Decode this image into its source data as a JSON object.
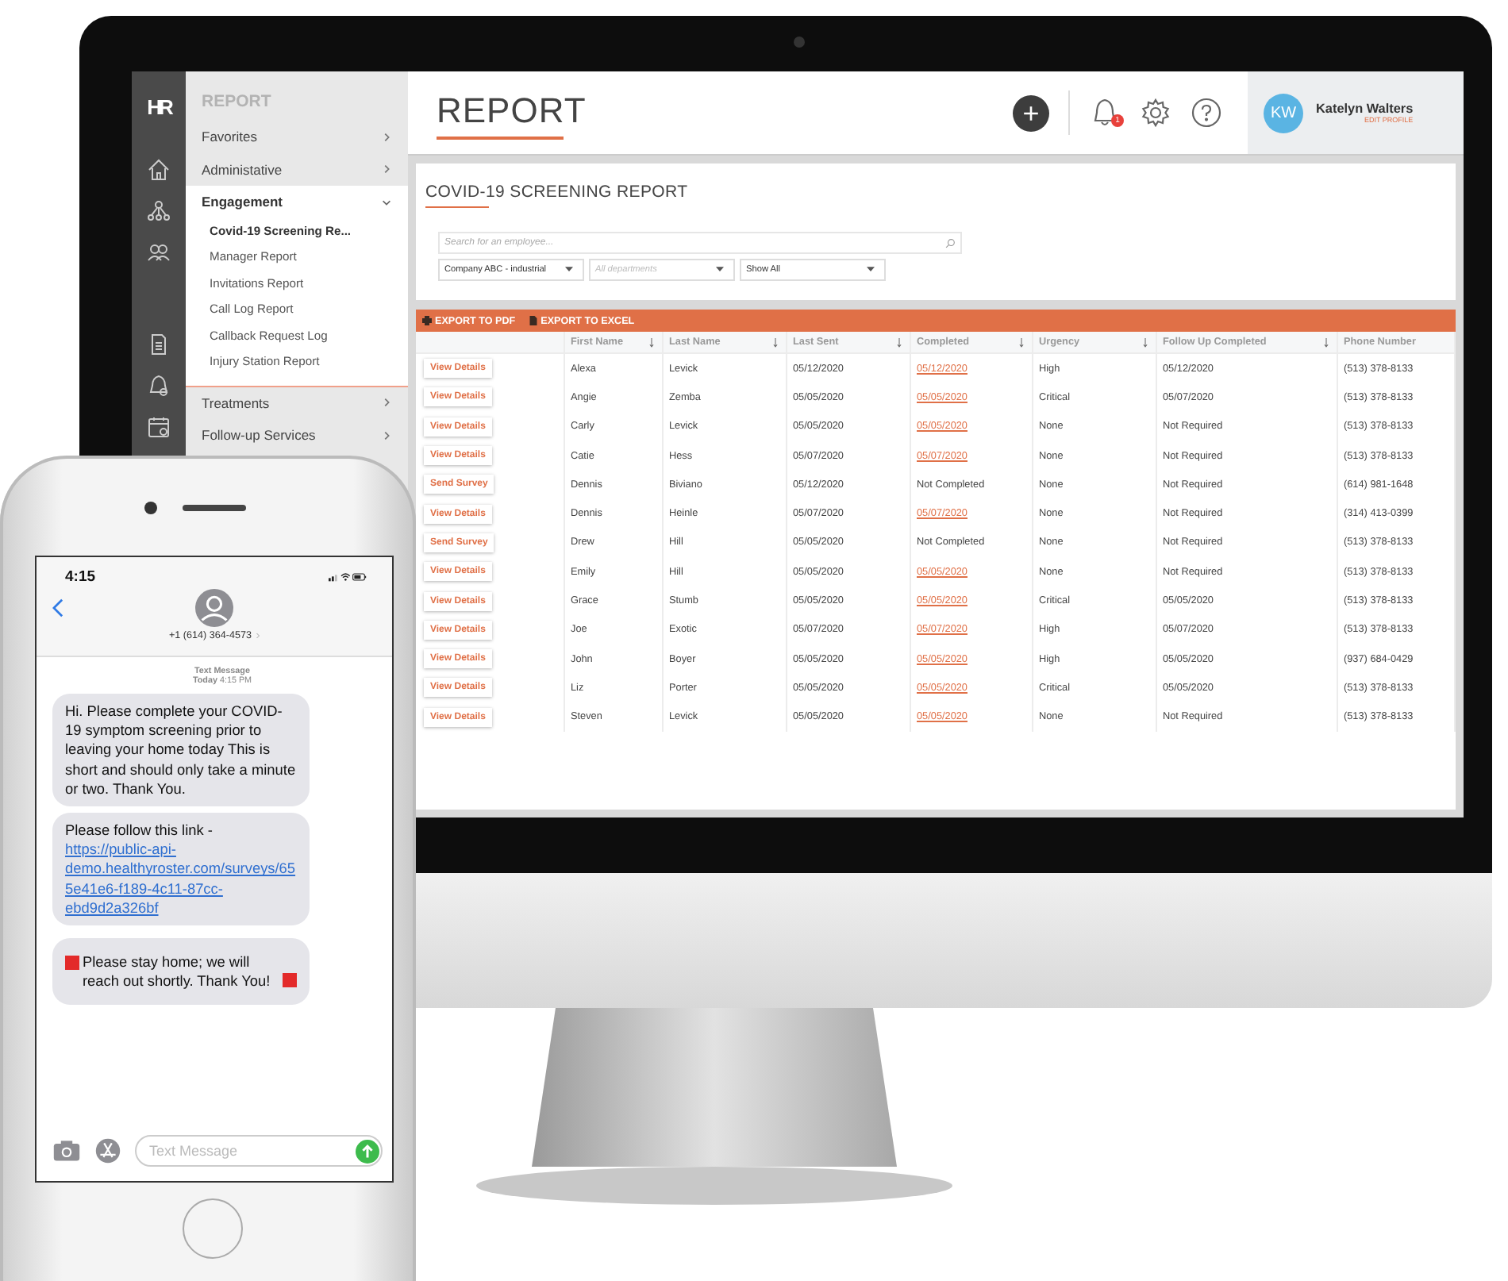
{
  "monitor": {
    "logo": "HR",
    "sidebar": {
      "heading": "REPORT",
      "sections": [
        {
          "label": "Favorites",
          "expanded": false
        },
        {
          "label": "Administative",
          "expanded": false
        },
        {
          "label": "Engagement",
          "expanded": true,
          "children": [
            {
              "label": "Covid-19 Screening Re...",
              "selected": true
            },
            {
              "label": "Manager Report",
              "selected": false
            },
            {
              "label": "Invitations Report",
              "selected": false
            },
            {
              "label": "Call Log Report",
              "selected": false
            },
            {
              "label": "Callback Request Log",
              "selected": false
            },
            {
              "label": "Injury Station Report",
              "selected": false
            }
          ]
        },
        {
          "label": "Treatments",
          "expanded": false
        },
        {
          "label": "Follow-up Services",
          "expanded": false
        }
      ]
    },
    "header": {
      "title": "REPORT",
      "notification_count": "1",
      "user": {
        "initials": "KW",
        "name": "Katelyn Walters",
        "link": "EDIT PROFILE"
      }
    },
    "report": {
      "title": "COVID-19 SCREENING REPORT",
      "search": {
        "placeholder": "Search for an employee..."
      },
      "filters": [
        {
          "value": "Company ABC - industrial"
        },
        {
          "placeholder": "All departments"
        },
        {
          "value": "Show All"
        }
      ],
      "exports": [
        {
          "label": "EXPORT TO PDF",
          "kind": "pdf"
        },
        {
          "label": "EXPORT TO EXCEL",
          "kind": "excel"
        }
      ],
      "table": {
        "columns": [
          {
            "label": "First Name",
            "sortable": true
          },
          {
            "label": "Last Name",
            "sortable": true
          },
          {
            "label": "Last Sent",
            "sortable": true
          },
          {
            "label": "Completed",
            "sortable": true
          },
          {
            "label": "Urgency",
            "sortable": true
          },
          {
            "label": "Follow Up Completed",
            "sortable": true
          },
          {
            "label": "Phone Number",
            "sortable": false
          }
        ],
        "rows": [
          {
            "action": "View Details",
            "cells": [
              "Alexa",
              "Levick",
              "05/12/2020",
              {
                "text": "05/12/2020",
                "link": true
              },
              "High",
              "05/12/2020",
              "(513) 378-8133"
            ]
          },
          {
            "action": "View Details",
            "cells": [
              "Angie",
              "Zemba",
              "05/05/2020",
              {
                "text": "05/05/2020",
                "link": true
              },
              "Critical",
              "05/07/2020",
              "(513) 378-8133"
            ]
          },
          {
            "action": "View Details",
            "cells": [
              "Carly",
              "Levick",
              "05/05/2020",
              {
                "text": "05/05/2020",
                "link": true
              },
              "None",
              "Not Required",
              "(513) 378-8133"
            ]
          },
          {
            "action": "View Details",
            "cells": [
              "Catie",
              "Hess",
              "05/07/2020",
              {
                "text": "05/07/2020",
                "link": true
              },
              "None",
              "Not Required",
              "(513) 378-8133"
            ]
          },
          {
            "action": "Send Survey",
            "cells": [
              "Dennis",
              "Biviano",
              "05/12/2020",
              {
                "text": "Not Completed",
                "link": false
              },
              "None",
              "Not Required",
              "(614) 981-1648"
            ]
          },
          {
            "action": "View Details",
            "cells": [
              "Dennis",
              "Heinle",
              "05/07/2020",
              {
                "text": "05/07/2020",
                "link": true
              },
              "None",
              "Not Required",
              "(314) 413-0399"
            ]
          },
          {
            "action": "Send Survey",
            "cells": [
              "Drew",
              "Hill",
              "05/05/2020",
              {
                "text": "Not Completed",
                "link": false
              },
              "None",
              "Not Required",
              "(513) 378-8133"
            ]
          },
          {
            "action": "View Details",
            "cells": [
              "Emily",
              "Hill",
              "05/05/2020",
              {
                "text": "05/05/2020",
                "link": true
              },
              "None",
              "Not Required",
              "(513) 378-8133"
            ]
          },
          {
            "action": "View Details",
            "cells": [
              "Grace",
              "Stumb",
              "05/05/2020",
              {
                "text": "05/05/2020",
                "link": true
              },
              "Critical",
              "05/05/2020",
              "(513) 378-8133"
            ]
          },
          {
            "action": "View Details",
            "cells": [
              "Joe",
              "Exotic",
              "05/07/2020",
              {
                "text": "05/07/2020",
                "link": true
              },
              "High",
              "05/07/2020",
              "(513) 378-8133"
            ]
          },
          {
            "action": "View Details",
            "cells": [
              "John",
              "Boyer",
              "05/05/2020",
              {
                "text": "05/05/2020",
                "link": true
              },
              "High",
              "05/05/2020",
              "(937) 684-0429"
            ]
          },
          {
            "action": "View Details",
            "cells": [
              "Liz",
              "Porter",
              "05/05/2020",
              {
                "text": "05/05/2020",
                "link": true
              },
              "Critical",
              "05/05/2020",
              "(513) 378-8133"
            ]
          },
          {
            "action": "View Details",
            "cells": [
              "Steven",
              "Levick",
              "05/05/2020",
              {
                "text": "05/05/2020",
                "link": true
              },
              "None",
              "Not Required",
              "(513) 378-8133"
            ]
          }
        ]
      }
    }
  },
  "phone": {
    "time": "4:15",
    "contact": "+1 (614) 364-4573",
    "thread_label": "Text Message",
    "thread_time": "**Today** 4:15 PM",
    "messages": [
      {
        "kind": "text",
        "text": "Hi. Please complete your COVID-19 symptom screening prior to leaving your home today This is short and should only take a minute or two. Thank You."
      },
      {
        "kind": "link",
        "text": "Please follow this link -",
        "link": "https://public-api-demo.healthyroster.com/surveys/655e41e6-f189-4c11-87cc-ebd9d2a326bf"
      },
      {
        "kind": "alert",
        "text": "Please stay home; we will reach out shortly. Thank You!"
      }
    ],
    "input": {
      "placeholder": "Text Message"
    }
  }
}
